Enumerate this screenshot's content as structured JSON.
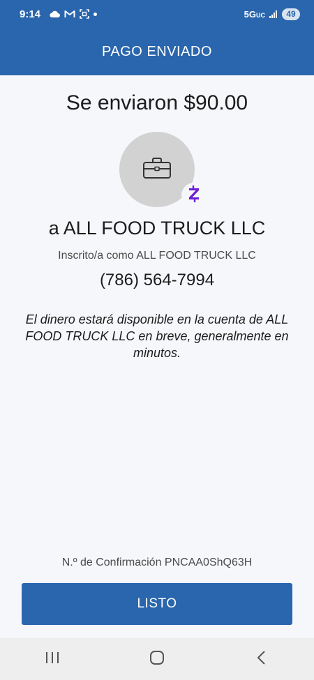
{
  "status_bar": {
    "time": "9:14",
    "network": "5G",
    "network_sub": "UC",
    "battery": "49"
  },
  "header": {
    "title": "PAGO ENVIADO"
  },
  "payment": {
    "amount_text": "Se enviaron $90.00",
    "recipient_text": "a ALL FOOD TRUCK LLC",
    "enrolled_text": "Inscrito/a como ALL FOOD TRUCK LLC",
    "phone": "(786) 564-7994",
    "info_text": "El dinero estará disponible en la cuenta de ALL FOOD TRUCK LLC en breve, generalmente en minutos.",
    "confirmation_text": "N.º de Confirmación PNCAA0ShQ63H"
  },
  "actions": {
    "done_label": "LISTO"
  },
  "colors": {
    "brand_blue": "#2a66ad",
    "zelle_purple": "#6d1ed4",
    "background": "#f5f7fa"
  },
  "icons": {
    "avatar": "briefcase-icon",
    "badge": "zelle-logo-icon",
    "nav": [
      "recent-apps-icon",
      "home-icon",
      "back-icon"
    ]
  }
}
